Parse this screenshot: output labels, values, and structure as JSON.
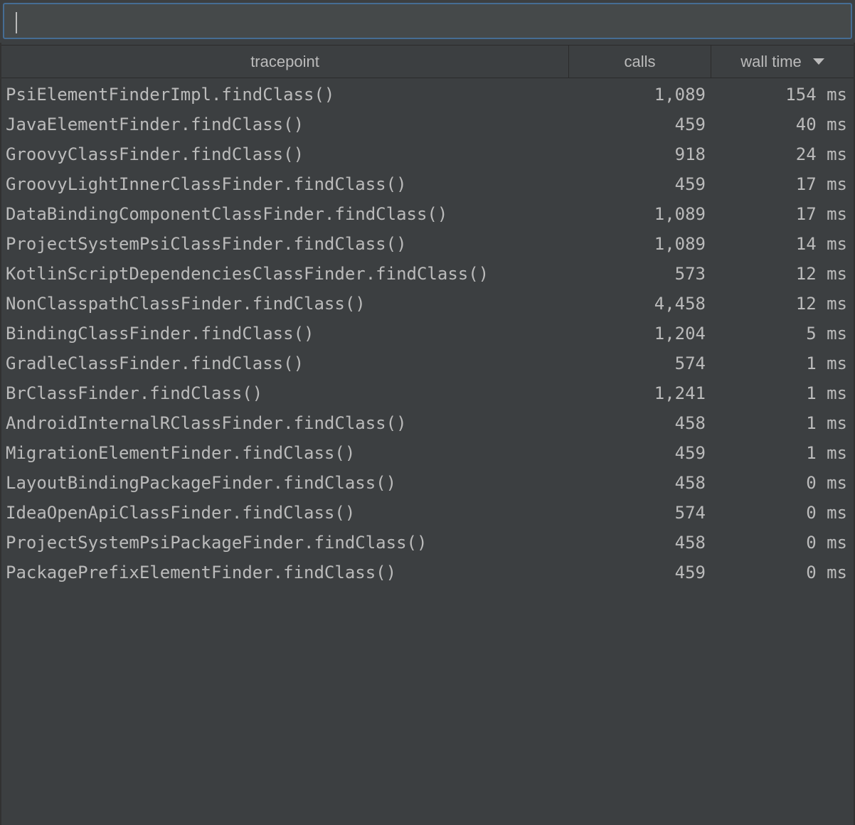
{
  "search": {
    "value": "",
    "placeholder": ""
  },
  "table": {
    "columns": {
      "tracepoint": "tracepoint",
      "calls": "calls",
      "wall_time": "wall time"
    },
    "sort": {
      "column": "wall time",
      "direction": "descending",
      "icon": "triangle-down-icon"
    },
    "rows": [
      {
        "tracepoint": "PsiElementFinderImpl.findClass()",
        "calls": "1,089",
        "wall_time": "154 ms"
      },
      {
        "tracepoint": "JavaElementFinder.findClass()",
        "calls": "459",
        "wall_time": "40 ms"
      },
      {
        "tracepoint": "GroovyClassFinder.findClass()",
        "calls": "918",
        "wall_time": "24 ms"
      },
      {
        "tracepoint": "GroovyLightInnerClassFinder.findClass()",
        "calls": "459",
        "wall_time": "17 ms"
      },
      {
        "tracepoint": "DataBindingComponentClassFinder.findClass()",
        "calls": "1,089",
        "wall_time": "17 ms"
      },
      {
        "tracepoint": "ProjectSystemPsiClassFinder.findClass()",
        "calls": "1,089",
        "wall_time": "14 ms"
      },
      {
        "tracepoint": "KotlinScriptDependenciesClassFinder.findClass()",
        "calls": "573",
        "wall_time": "12 ms"
      },
      {
        "tracepoint": "NonClasspathClassFinder.findClass()",
        "calls": "4,458",
        "wall_time": "12 ms"
      },
      {
        "tracepoint": "BindingClassFinder.findClass()",
        "calls": "1,204",
        "wall_time": "5 ms"
      },
      {
        "tracepoint": "GradleClassFinder.findClass()",
        "calls": "574",
        "wall_time": "1 ms"
      },
      {
        "tracepoint": "BrClassFinder.findClass()",
        "calls": "1,241",
        "wall_time": "1 ms"
      },
      {
        "tracepoint": "AndroidInternalRClassFinder.findClass()",
        "calls": "458",
        "wall_time": "1 ms"
      },
      {
        "tracepoint": "MigrationElementFinder.findClass()",
        "calls": "459",
        "wall_time": "1 ms"
      },
      {
        "tracepoint": "LayoutBindingPackageFinder.findClass()",
        "calls": "458",
        "wall_time": "0 ms"
      },
      {
        "tracepoint": "IdeaOpenApiClassFinder.findClass()",
        "calls": "574",
        "wall_time": "0 ms"
      },
      {
        "tracepoint": "ProjectSystemPsiPackageFinder.findClass()",
        "calls": "458",
        "wall_time": "0 ms"
      },
      {
        "tracepoint": "PackagePrefixElementFinder.findClass()",
        "calls": "459",
        "wall_time": "0 ms"
      }
    ]
  },
  "colors": {
    "background": "#3c3f41",
    "input_background": "#45494a",
    "focus_border": "#466d94",
    "text": "#bbbbbb",
    "divider": "#2b2b2b"
  }
}
